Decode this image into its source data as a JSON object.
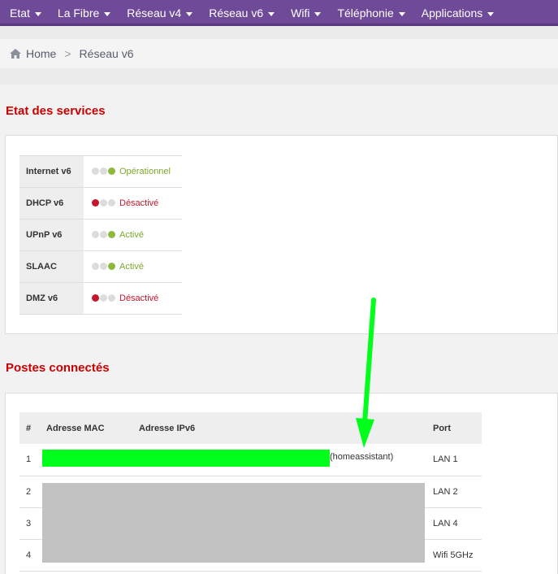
{
  "nav": {
    "items": [
      {
        "label": "Etat"
      },
      {
        "label": "La Fibre"
      },
      {
        "label": "Réseau v4"
      },
      {
        "label": "Réseau v6"
      },
      {
        "label": "Wifi"
      },
      {
        "label": "Téléphonie"
      },
      {
        "label": "Applications"
      }
    ]
  },
  "breadcrumb": {
    "home": "Home",
    "separator": ">",
    "current": "Réseau v6"
  },
  "services": {
    "title": "Etat des services",
    "rows": [
      {
        "name": "Internet v6",
        "status": "Opérationnel",
        "state": "green"
      },
      {
        "name": "DHCP v6",
        "status": "Désactivé",
        "state": "red"
      },
      {
        "name": "UPnP v6",
        "status": "Activé",
        "state": "green"
      },
      {
        "name": "SLAAC",
        "status": "Activé",
        "state": "green"
      },
      {
        "name": "DMZ v6",
        "status": "Désactivé",
        "state": "red"
      }
    ]
  },
  "devices": {
    "title": "Postes connectés",
    "headers": {
      "num": "#",
      "mac": "Adresse MAC",
      "ip": "Adresse IPv6",
      "port": "Port"
    },
    "rows": [
      {
        "num": "1",
        "host": "(homeassistant)",
        "port": "LAN 1"
      },
      {
        "num": "2",
        "port": "LAN 2"
      },
      {
        "num": "3",
        "port": "LAN 4"
      },
      {
        "num": "4",
        "port": "Wifi 5GHz"
      }
    ]
  },
  "colors": {
    "nav_bg": "#6e4a98",
    "title_red": "#cc0000",
    "status_green": "#7ca82c",
    "status_red": "#c4172c",
    "annotation_green": "#00ff1a",
    "redaction_grey": "#c2c2c2"
  }
}
